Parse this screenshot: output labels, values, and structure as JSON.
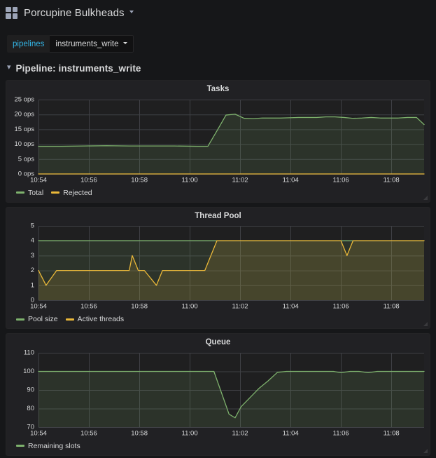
{
  "navbar": {
    "icon": "grid-apps-icon",
    "dashboard_title": "Porcupine Bulkheads",
    "caret": "chevron-down-icon"
  },
  "variables": {
    "label": "pipelines",
    "value": "instruments_write"
  },
  "row": {
    "chevron": "chevron-down-icon",
    "title": "Pipeline: instruments_write"
  },
  "colors": {
    "green": "#7eb26d",
    "orange": "#eab839",
    "accent_cyan": "#33b5e5",
    "panel_bg": "#212124",
    "page_bg": "#161719",
    "grid": "#3f4045",
    "text": "#d8d9da"
  },
  "panels": [
    {
      "title": "Tasks",
      "legend": [
        {
          "label": "Total",
          "color": "#7eb26d"
        },
        {
          "label": "Rejected",
          "color": "#eab839"
        }
      ]
    },
    {
      "title": "Thread Pool",
      "legend": [
        {
          "label": "Pool size",
          "color": "#7eb26d"
        },
        {
          "label": "Active threads",
          "color": "#eab839"
        }
      ]
    },
    {
      "title": "Queue",
      "legend": [
        {
          "label": "Remaining slots",
          "color": "#7eb26d"
        }
      ]
    }
  ],
  "chart_data": [
    {
      "type": "line",
      "title": "Tasks",
      "xlabel": "",
      "ylabel": "",
      "grid": true,
      "legend_position": "bottom-left",
      "xlim": [
        10.9,
        11.155
      ],
      "xticks": [
        10.9,
        10.9333,
        10.9667,
        11.0,
        11.0333,
        11.0667,
        11.1,
        11.1333
      ],
      "xticklabels": [
        "10:54",
        "10:56",
        "10:58",
        "11:00",
        "11:02",
        "11:04",
        "11:06",
        "11:08"
      ],
      "ylim": [
        0,
        25
      ],
      "yticks": [
        0,
        5,
        10,
        15,
        20,
        25
      ],
      "yticklabels": [
        "0 ops",
        "5 ops",
        "10 ops",
        "15 ops",
        "20 ops",
        "25 ops"
      ],
      "series": [
        {
          "name": "Total",
          "color": "#7eb26d",
          "fill": true,
          "x": [
            10.9,
            10.915,
            10.93,
            10.945,
            10.96,
            10.975,
            10.99,
            11.005,
            11.012,
            11.018,
            11.024,
            11.03,
            11.036,
            11.042,
            11.048,
            11.054,
            11.06,
            11.066,
            11.072,
            11.078,
            11.084,
            11.09,
            11.096,
            11.102,
            11.108,
            11.114,
            11.12,
            11.126,
            11.132,
            11.138,
            11.144,
            11.15,
            11.155
          ],
          "y": [
            9.3,
            9.3,
            9.4,
            9.5,
            9.4,
            9.4,
            9.4,
            9.3,
            9.3,
            14.5,
            19.8,
            20.1,
            18.7,
            18.6,
            18.8,
            18.8,
            18.8,
            18.9,
            19.0,
            19.0,
            19.0,
            19.2,
            19.2,
            19.0,
            18.7,
            18.8,
            19.0,
            18.8,
            18.8,
            18.8,
            19.0,
            19.0,
            16.6
          ]
        },
        {
          "name": "Rejected",
          "color": "#eab839",
          "fill": true,
          "x": [
            10.9,
            11.155
          ],
          "y": [
            0,
            0
          ]
        }
      ]
    },
    {
      "type": "line",
      "title": "Thread Pool",
      "xlabel": "",
      "ylabel": "",
      "grid": true,
      "legend_position": "bottom-left",
      "xlim": [
        10.9,
        11.155
      ],
      "xticks": [
        10.9,
        10.9333,
        10.9667,
        11.0,
        11.0333,
        11.0667,
        11.1,
        11.1333
      ],
      "xticklabels": [
        "10:54",
        "10:56",
        "10:58",
        "11:00",
        "11:02",
        "11:04",
        "11:06",
        "11:08"
      ],
      "ylim": [
        0,
        5
      ],
      "yticks": [
        0,
        1,
        2,
        3,
        4,
        5
      ],
      "yticklabels": [
        "0",
        "1",
        "2",
        "3",
        "4",
        "5"
      ],
      "series": [
        {
          "name": "Pool size",
          "color": "#7eb26d",
          "fill": true,
          "x": [
            10.9,
            11.155
          ],
          "y": [
            4,
            4
          ]
        },
        {
          "name": "Active threads",
          "color": "#eab839",
          "fill": true,
          "x": [
            10.9,
            10.905,
            10.912,
            10.96,
            10.962,
            10.966,
            10.97,
            10.978,
            10.982,
            10.986,
            10.99,
            11.01,
            11.018,
            11.022,
            11.026,
            11.1,
            11.104,
            11.108,
            11.155
          ],
          "y": [
            2,
            1,
            2,
            2,
            3,
            2,
            2,
            1,
            2,
            2,
            2,
            2,
            4,
            4,
            4,
            4,
            3,
            4,
            4
          ]
        }
      ]
    },
    {
      "type": "line",
      "title": "Queue",
      "xlabel": "",
      "ylabel": "",
      "grid": true,
      "legend_position": "bottom-left",
      "xlim": [
        10.9,
        11.155
      ],
      "xticks": [
        10.9,
        10.9333,
        10.9667,
        11.0,
        11.0333,
        11.0667,
        11.1,
        11.1333
      ],
      "xticklabels": [
        "10:54",
        "10:56",
        "10:58",
        "11:00",
        "11:02",
        "11:04",
        "11:06",
        "11:08"
      ],
      "ylim": [
        70,
        110
      ],
      "yticks": [
        70,
        80,
        90,
        100,
        110
      ],
      "yticklabels": [
        "70",
        "80",
        "90",
        "100",
        "110"
      ],
      "series": [
        {
          "name": "Remaining slots",
          "color": "#7eb26d",
          "fill": true,
          "x": [
            10.9,
            11.016,
            11.026,
            11.03,
            11.034,
            11.04,
            11.046,
            11.052,
            11.058,
            11.064,
            11.07,
            11.095,
            11.1,
            11.106,
            11.112,
            11.118,
            11.124,
            11.13,
            11.155
          ],
          "y": [
            100,
            100,
            77,
            75,
            81,
            86,
            91,
            95,
            99.5,
            100,
            100,
            100,
            99.3,
            100,
            100,
            99.3,
            100,
            100,
            100
          ]
        }
      ]
    }
  ]
}
